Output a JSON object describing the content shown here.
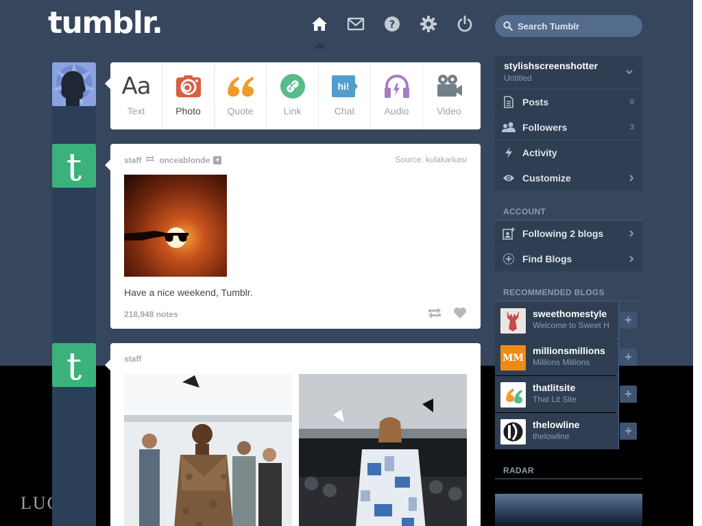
{
  "header": {
    "logo": "tumblr.",
    "search_placeholder": "Search Tumblr",
    "nav": [
      "home-icon",
      "inbox-icon",
      "help-icon",
      "settings-icon",
      "logout-icon"
    ]
  },
  "post_types": [
    {
      "label": "Text",
      "icon": "text-icon",
      "color": "#444444"
    },
    {
      "label": "Photo",
      "icon": "photo-icon",
      "color": "#d95e40"
    },
    {
      "label": "Quote",
      "icon": "quote-icon",
      "color": "#f2992e"
    },
    {
      "label": "Link",
      "icon": "link-icon",
      "color": "#56bc8a"
    },
    {
      "label": "Chat",
      "icon": "chat-icon",
      "color": "#529ecc"
    },
    {
      "label": "Audio",
      "icon": "audio-icon",
      "color": "#a77dc2"
    },
    {
      "label": "Video",
      "icon": "video-icon",
      "color": "#748089"
    }
  ],
  "posts": [
    {
      "author": "staff",
      "reblogged_from": "onceablonde",
      "source_label": "Source:",
      "source": "kulakarkasi",
      "caption": "Have a nice weekend, Tumblr.",
      "notes": "218,948 notes"
    },
    {
      "author": "staff"
    }
  ],
  "sidebar": {
    "blog": {
      "name": "stylishscreenshotter",
      "title": "Untitled"
    },
    "items": [
      {
        "label": "Posts",
        "count": "0",
        "icon": "posts-icon"
      },
      {
        "label": "Followers",
        "count": "3",
        "icon": "followers-icon"
      },
      {
        "label": "Activity",
        "icon": "activity-icon"
      },
      {
        "label": "Customize",
        "icon": "customize-icon"
      }
    ],
    "account_heading": "ACCOUNT",
    "account_items": [
      {
        "label": "Following 2 blogs",
        "icon": "following-icon"
      },
      {
        "label": "Find Blogs",
        "icon": "find-blogs-icon"
      }
    ],
    "recommended_heading": "RECOMMENDED BLOGS",
    "recommended": [
      {
        "name": "sweethomestyle",
        "title": "Welcome to Sweet H"
      },
      {
        "name": "millionsmillions",
        "title": "Millions Millions",
        "avatar_text": "MM"
      },
      {
        "name": "thatlitsite",
        "title": "That Lit Site"
      },
      {
        "name": "thelowline",
        "title": "thelowline"
      }
    ],
    "radar_heading": "RADAR"
  },
  "background_text": "LUC",
  "colors": {
    "dashboard_bg": "#36465d",
    "sidebar_bg": "#2f3e52",
    "tumblr_green": "#3bb27b"
  }
}
